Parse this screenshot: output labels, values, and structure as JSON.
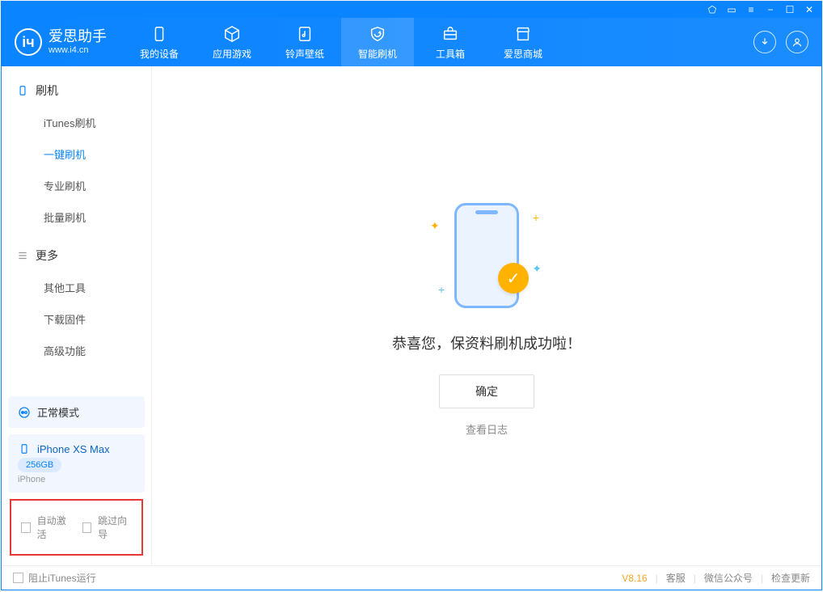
{
  "app": {
    "name": "爱思助手",
    "url": "www.i4.cn"
  },
  "titlebar": {
    "icons": [
      "lock",
      "page",
      "menu",
      "min",
      "max",
      "close"
    ]
  },
  "nav": {
    "items": [
      {
        "label": "我的设备",
        "icon": "device"
      },
      {
        "label": "应用游戏",
        "icon": "cube"
      },
      {
        "label": "铃声壁纸",
        "icon": "music"
      },
      {
        "label": "智能刷机",
        "icon": "refresh-shield",
        "active": true
      },
      {
        "label": "工具箱",
        "icon": "toolbox"
      },
      {
        "label": "爱思商城",
        "icon": "store"
      }
    ]
  },
  "sidebar": {
    "sections": [
      {
        "title": "刷机",
        "icon": "phone",
        "items": [
          {
            "label": "iTunes刷机"
          },
          {
            "label": "一键刷机",
            "active": true
          },
          {
            "label": "专业刷机"
          },
          {
            "label": "批量刷机"
          }
        ]
      },
      {
        "title": "更多",
        "icon": "list",
        "items": [
          {
            "label": "其他工具"
          },
          {
            "label": "下载固件"
          },
          {
            "label": "高级功能"
          }
        ]
      }
    ],
    "mode": {
      "label": "正常模式",
      "icon": "cycle"
    },
    "device": {
      "name": "iPhone XS Max",
      "capacity": "256GB",
      "type": "iPhone"
    },
    "checkboxes": {
      "auto_activate": "自动激活",
      "skip_guide": "跳过向导"
    }
  },
  "main": {
    "success_text": "恭喜您，保资料刷机成功啦！",
    "ok_button": "确定",
    "log_link": "查看日志"
  },
  "statusbar": {
    "block_itunes": "阻止iTunes运行",
    "version": "V8.16",
    "links": [
      "客服",
      "微信公众号",
      "检查更新"
    ]
  }
}
